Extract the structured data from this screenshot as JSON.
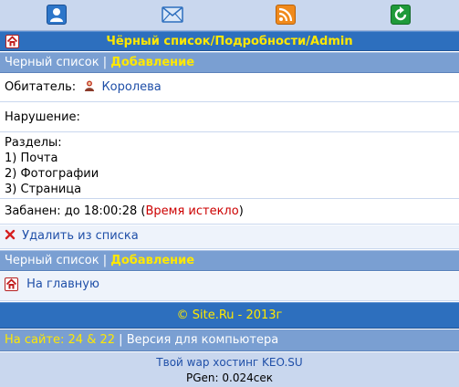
{
  "top_nav": {
    "icons": [
      "user-icon",
      "mail-icon",
      "rss-icon",
      "refresh-icon"
    ]
  },
  "title": "Чёрный список/Подробности/Admin",
  "crumb": {
    "list_label": "Черный список",
    "separator": "|",
    "add_label": "Добавление"
  },
  "details": {
    "resident_label": "Обитатель:",
    "resident_name": "Королева",
    "violation_label": "Нарушение:",
    "sections_label": "Разделы:",
    "sections": [
      "1) Почта",
      "2) Фотографии",
      "3) Страница"
    ],
    "banned_label": "Забанен: до 18:00:28",
    "banned_open": "(",
    "banned_status": "Время истекло",
    "banned_close": ")"
  },
  "actions": {
    "remove_label": "Удалить из списка",
    "home_label": "На главную"
  },
  "footer": {
    "copyright": "© Site.Ru - 2013г",
    "online_label": "На сайте: 24 & 22",
    "separator": "|",
    "desktop_link": "Версия для компьютера",
    "hosting": "Твой wap хостинг KEO.SU",
    "pgen": "PGen: 0.024сек"
  },
  "colors": {
    "header_blue": "#2d6fbe",
    "band_blue": "#7a9fd2",
    "nav_bg": "#c9d7ee",
    "accent_yellow": "#ffe800",
    "link_blue": "#1f4fa8",
    "alert_red": "#cc0000"
  }
}
